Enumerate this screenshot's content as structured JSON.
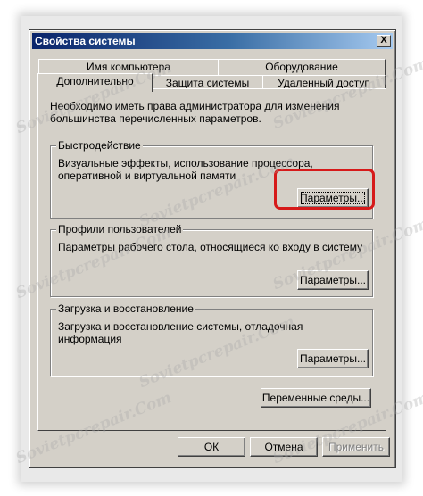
{
  "window": {
    "title": "Свойства системы",
    "close_symbol": "X"
  },
  "tabs": {
    "row1": [
      "Имя компьютера",
      "Оборудование"
    ],
    "row2": [
      "Дополнительно",
      "Защита системы",
      "Удаленный доступ"
    ],
    "active": "Дополнительно"
  },
  "panel": {
    "notice": "Необходимо иметь права администратора для изменения большинства перечисленных параметров.",
    "performance": {
      "title": "Быстродействие",
      "description": "Визуальные эффекты, использование процессора, оперативной и виртуальной памяти",
      "button": "Параметры..."
    },
    "profiles": {
      "title": "Профили пользователей",
      "description": "Параметры рабочего стола, относящиеся ко входу в систему",
      "button": "Параметры..."
    },
    "startup": {
      "title": "Загрузка и восстановление",
      "description": "Загрузка и восстановление системы, отладочная информация",
      "button": "Параметры..."
    },
    "env_button": "Переменные среды..."
  },
  "footer": {
    "ok": "ОК",
    "cancel": "Отмена",
    "apply": "Применить"
  },
  "watermark": "Sovietpcrepair.Com",
  "colors": {
    "titlebar_start": "#0a246a",
    "titlebar_end": "#a6caf0",
    "dialog_bg": "#d4d0c8",
    "highlight": "#d61a1a"
  }
}
